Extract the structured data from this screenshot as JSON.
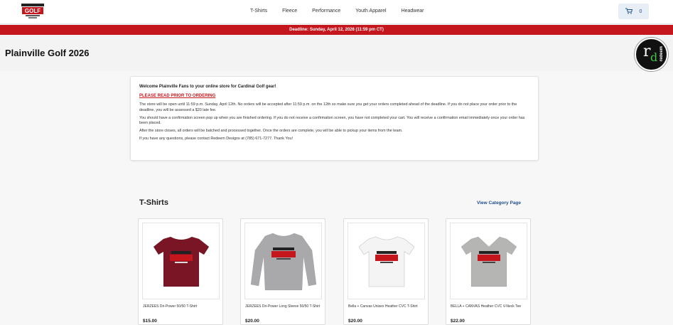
{
  "brand": {
    "logo_text": "GOLF",
    "logo_sub": "PLAINVILLE"
  },
  "nav": {
    "items": [
      "T-Shirts",
      "Fleece",
      "Performance",
      "Youth Apparel",
      "Headwear"
    ]
  },
  "cart": {
    "count": "0"
  },
  "deadline": {
    "text": "Deadline: Sunday, April 12, 2026 (11:59 pm CT)"
  },
  "page": {
    "title": "Plainville Golf 2026"
  },
  "badge": {
    "text": "redeem"
  },
  "notice": {
    "welcome": "Welcome Plainville Fans to your online store for Cardinal Golf gear!",
    "warning": "PLEASE READ PRIOR TO ORDERING",
    "p1": "The store will be open until 11:59 p.m. Sunday, April 12th. No orders will be accepted after 11:59 p.m. on the 12th so make sure you get your orders completed ahead of the deadline. If you do not place your order prior to the deadline, you will be assessed a $20 late fee.",
    "p2": "You should have a confirmation screen pop up when you are finished ordering. If you do not receive a confirmation screen, you have not completed your cart. You will receive a confirmation email immediately once your order has been placed.",
    "p3": "After the store closes, all orders will be batched and processed together. Once the orders are complete, you will be able to pickup your items from the team.",
    "p4": "If you have any questions, please contact Redeem Designs at (785) 671-7277. Thank You!"
  },
  "section": {
    "title": "T-Shirts",
    "link": "View Category Page"
  },
  "products": [
    {
      "name": "JERZEES Dri-Power 50/50 T-Shirt",
      "price": "$15.00",
      "shirt_color": "#7a1526"
    },
    {
      "name": "JERZEES Dri-Power Long Sleeve 50/50 T-Shirt",
      "price": "$20.00",
      "shirt_color": "#a9a9ab"
    },
    {
      "name": "Bella + Canvas Unisex Heather CVC T-Shirt",
      "price": "$20.00",
      "shirt_color": "#f4f4f4"
    },
    {
      "name": "BELLA + CANVAS Heather CVC V-Neck Tee",
      "price": "$22.00",
      "shirt_color": "#b5b5b3"
    }
  ],
  "colors": {
    "accent": "#c4161c",
    "link": "#1f4f8f",
    "brand_green": "#3ec44b"
  }
}
